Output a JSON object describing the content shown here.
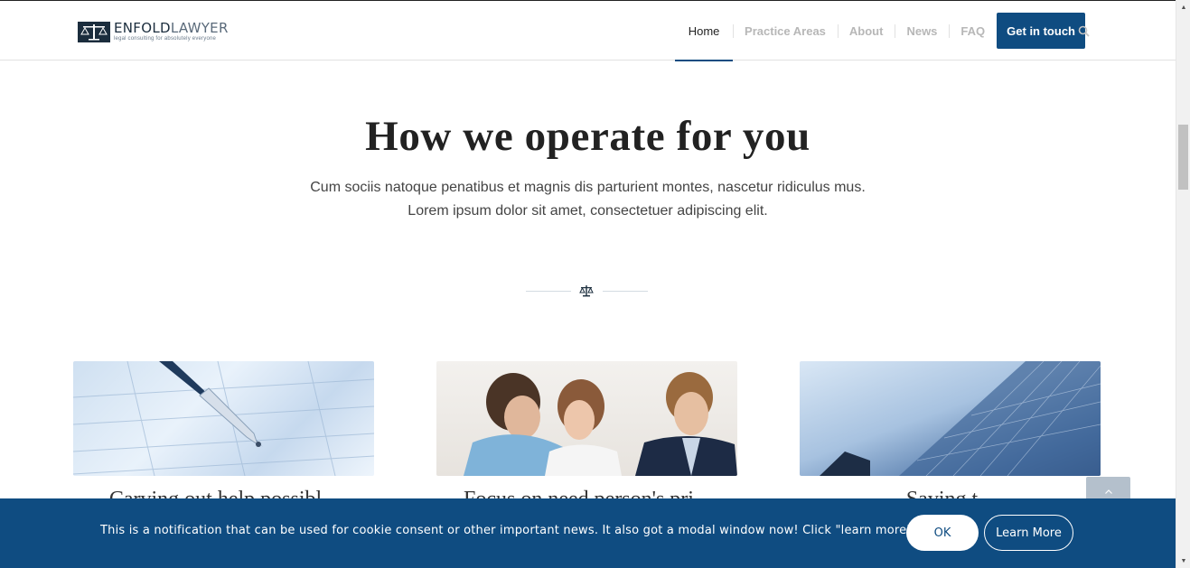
{
  "header": {
    "logo": {
      "name_bold": "ENFOLD",
      "name_light": "LAWYER",
      "tagline": "legal consulting for absolutely everyone"
    },
    "nav": {
      "items": [
        {
          "label": "Home",
          "active": true
        },
        {
          "label": "Practice Areas",
          "active": false
        },
        {
          "label": "About",
          "active": false
        },
        {
          "label": "News",
          "active": false
        },
        {
          "label": "FAQ",
          "active": false
        }
      ],
      "cta_label": "Get in touch",
      "search_icon": "search-icon"
    }
  },
  "intro": {
    "heading": "How we operate for you",
    "line1": "Cum sociis natoque penatibus et magnis dis parturient montes, nascetur ridiculus mus.",
    "line2": "Lorem ipsum dolor sit amet, consectetuer adipiscing elit.",
    "divider_icon": "scales-icon"
  },
  "cards": [
    {
      "image": "pen-on-form-image",
      "title": "Carving out help possibl..."
    },
    {
      "image": "consultation-meeting-image",
      "title": "Focus on need person's pri..."
    },
    {
      "image": "office-building-image",
      "title": "Saving t..."
    }
  ],
  "scroll_top_icon": "chevron-up-icon",
  "cookie_bar": {
    "message": "This is a notification that can be used for cookie consent or other important news. It also got a modal window now! Click \"learn more\" to see it!",
    "ok_label": "OK",
    "learn_more_label": "Learn More"
  },
  "colors": {
    "brand": "#0f4c81",
    "nav_inactive": "#b7b7b7",
    "text_dark": "#222222"
  }
}
